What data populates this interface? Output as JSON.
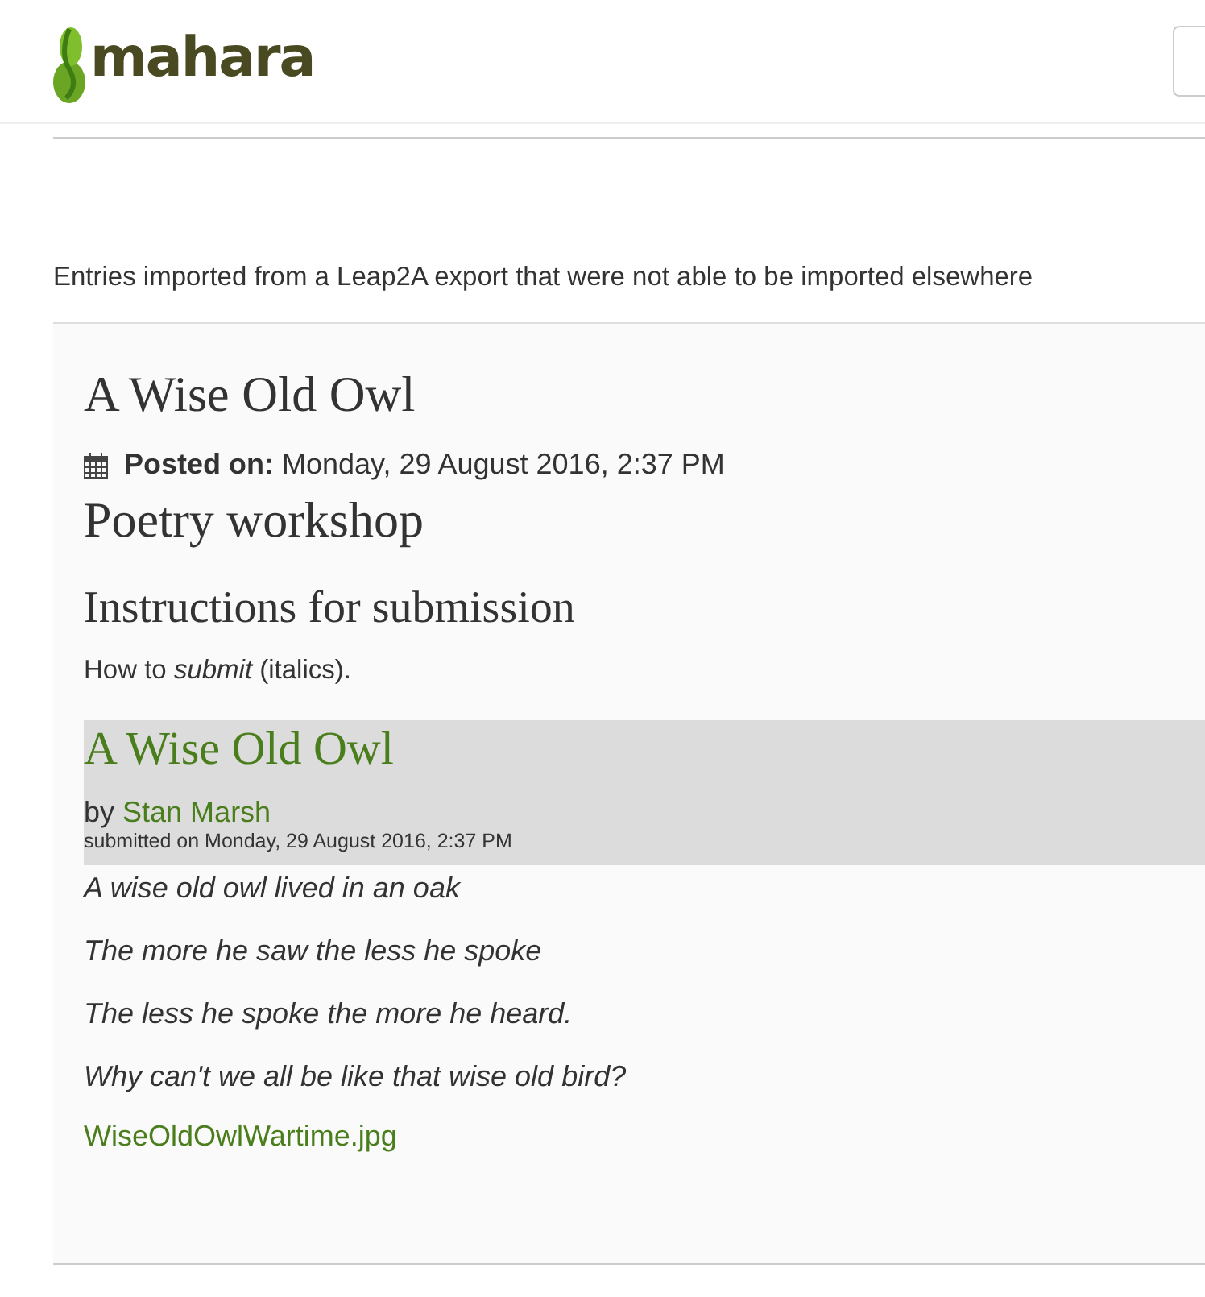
{
  "header": {
    "logo_text": "mahara"
  },
  "description": "Entries imported from a Leap2A export that were not able to be imported elsewhere",
  "entry": {
    "title": "A Wise Old Owl",
    "posted_label": "Posted on:",
    "posted_date": "Monday, 29 August 2016, 2:37 PM",
    "heading": "Poetry workshop",
    "subheading": "Instructions for submission",
    "instructions": "How to *submit* (italics).",
    "submission": {
      "title": "A Wise Old Owl",
      "by": "by",
      "author": "Stan Marsh",
      "submitted": "submitted on Monday, 29 August 2016, 2:37 PM"
    },
    "poem": [
      "A wise old owl lived in an oak",
      "The more he saw the less he spoke",
      "The less he spoke the more he heard.",
      "Why can't we all be like that wise old bird?"
    ],
    "attachment": "WiseOldOwlWartime.jpg"
  }
}
